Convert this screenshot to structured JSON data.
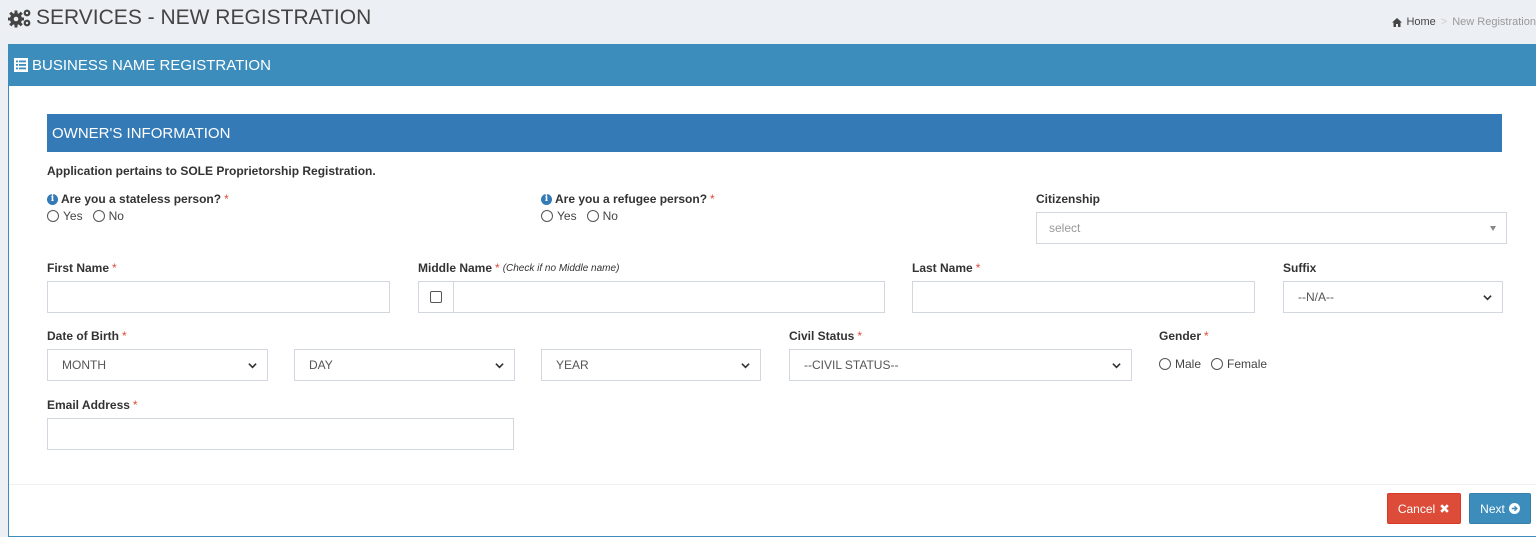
{
  "header": {
    "title": "SERVICES - NEW REGISTRATION",
    "breadcrumb": {
      "home": "Home",
      "current": "New Registration"
    }
  },
  "box": {
    "title": "BUSINESS NAME REGISTRATION"
  },
  "section": {
    "title": "OWNER'S INFORMATION"
  },
  "form": {
    "intro": "Application pertains to SOLE Proprietorship Registration.",
    "stateless": {
      "label": "Are you a stateless person?",
      "options": [
        "Yes",
        "No"
      ]
    },
    "refugee": {
      "label": "Are you a refugee person?",
      "options": [
        "Yes",
        "No"
      ]
    },
    "citizenship": {
      "label": "Citizenship",
      "placeholder": "select"
    },
    "first_name": {
      "label": "First Name",
      "value": ""
    },
    "middle_name": {
      "label": "Middle Name",
      "note": "(Check if no Middle name)",
      "value": ""
    },
    "last_name": {
      "label": "Last Name",
      "value": ""
    },
    "suffix": {
      "label": "Suffix",
      "selected": "--N/A--"
    },
    "dob": {
      "label": "Date of Birth",
      "month": "MONTH",
      "day": "DAY",
      "year": "YEAR"
    },
    "civil_status": {
      "label": "Civil Status",
      "selected": "--CIVIL STATUS--"
    },
    "gender": {
      "label": "Gender",
      "options": [
        "Male",
        "Female"
      ]
    },
    "email": {
      "label": "Email Address",
      "value": ""
    },
    "required_mark": "*"
  },
  "buttons": {
    "cancel": "Cancel",
    "next": "Next"
  },
  "colors": {
    "primary": "#3c8dbc",
    "section": "#337ab7",
    "danger": "#dd4b39",
    "required": "#dd4b39"
  }
}
